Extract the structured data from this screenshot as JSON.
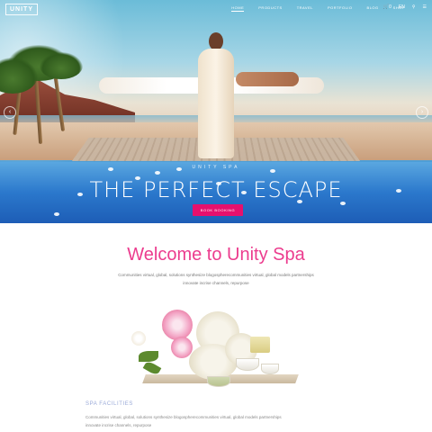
{
  "brand": {
    "logo_text": "UNITY"
  },
  "nav": {
    "items": [
      "HOME",
      "PRODUCTS",
      "TRAVEL",
      "PORTFOLIO",
      "BLOG",
      "SHOP"
    ],
    "cart_label": "0",
    "lang_label": "EN"
  },
  "hero": {
    "kicker": "UNITY SPA",
    "title": "THE PERFECT ESCAPE",
    "button_label": "BOOK BOOKING"
  },
  "welcome": {
    "title": "Welcome to Unity Spa",
    "intro_line1": "Communities virtual, global, solutions synthesize blogospherecommunities virtual, global models partnerships",
    "intro_line2": "innovate incrise channels, repurpose"
  },
  "facilities": {
    "label": "SPA FACILITIES",
    "text_line1": "Communities virtual, global, solutions synthesize blogospherecommunities virtual, global models partnerships",
    "text_line2": "innovate incrise channels, repurpose"
  },
  "colors": {
    "accent": "#e6106d",
    "heading": "#ec3c8e",
    "label": "#9aaad8"
  }
}
